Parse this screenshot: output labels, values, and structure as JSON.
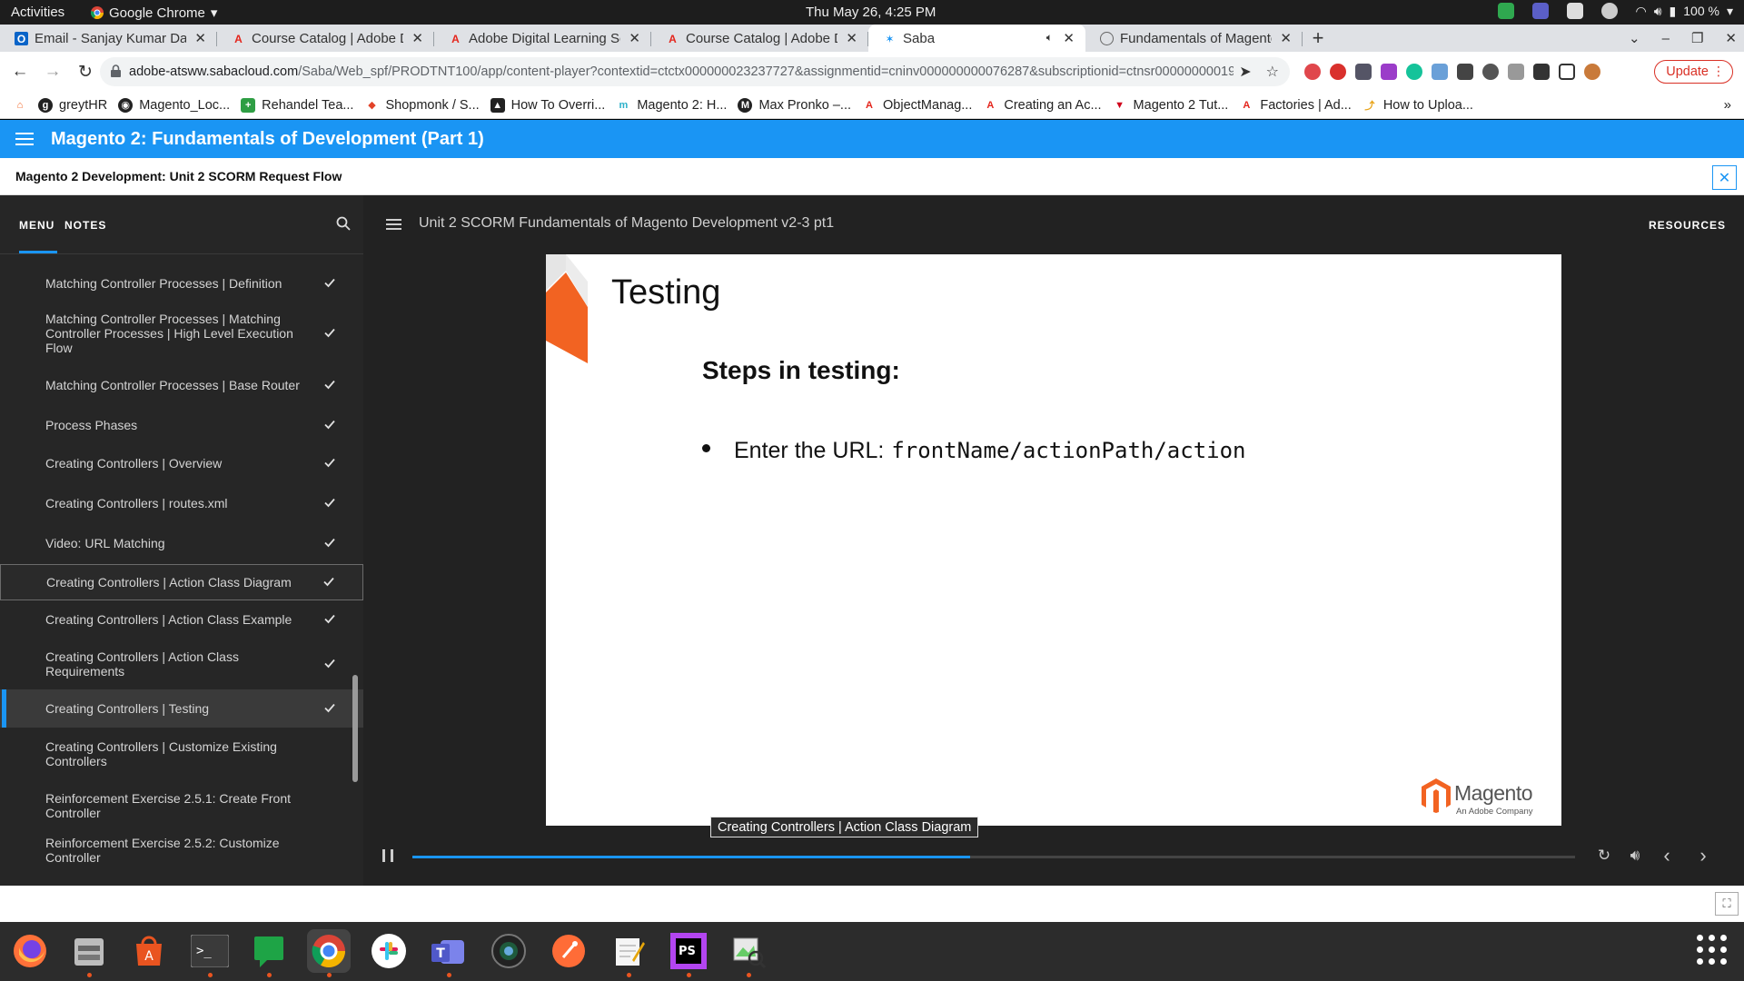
{
  "system": {
    "activities": "Activities",
    "app_name": "Google Chrome",
    "clock": "Thu May 26,  4:25 PM",
    "battery": "100 %"
  },
  "tabs": [
    {
      "label": "Email - Sanjay Kumar Das",
      "icon": "outlook-icon"
    },
    {
      "label": "Course Catalog | Adobe D",
      "icon": "adobe-icon"
    },
    {
      "label": "Adobe Digital Learning Se",
      "icon": "adobe-icon"
    },
    {
      "label": "Course Catalog | Adobe D",
      "icon": "adobe-icon"
    },
    {
      "label": "Saba",
      "icon": "saba-icon",
      "active": true
    },
    {
      "label": "Fundamentals of Magento",
      "icon": "globe-icon"
    }
  ],
  "toolbar": {
    "url_host": "adobe-atsww.sabacloud.com",
    "url_path": "/Saba/Web_spf/PRODTNT100/app/content-player?contextid=ctctx000000023237727&assignmentid=cninv000000000076287&subscriptionid=ctnsr00000000019...",
    "update_label": "Update"
  },
  "bookmarks": [
    {
      "label": "greytHR"
    },
    {
      "label": "Magento_Loc..."
    },
    {
      "label": "Rehandel Tea..."
    },
    {
      "label": "Shopmonk / S..."
    },
    {
      "label": "How To Overri..."
    },
    {
      "label": "Magento 2: H..."
    },
    {
      "label": "Max Pronko –..."
    },
    {
      "label": "ObjectManag..."
    },
    {
      "label": "Creating an Ac..."
    },
    {
      "label": "Magento 2 Tut..."
    },
    {
      "label": "Factories | Ad..."
    },
    {
      "label": "How to Uploa..."
    }
  ],
  "app": {
    "title": "Magento 2: Fundamentals of Development (Part 1)",
    "subtitle": "Magento 2 Development: Unit 2 SCORM Request Flow",
    "accent": "#1a95f4"
  },
  "sidebar": {
    "tab_menu": "MENU",
    "tab_notes": "NOTES",
    "items": [
      {
        "label": "Matching Controller Processes | Definition",
        "done": true
      },
      {
        "label": "Matching Controller Processes | Matching Controller Processes | High Level Execution Flow",
        "done": true
      },
      {
        "label": "Matching Controller Processes | Base Router",
        "done": true
      },
      {
        "label": "Process Phases",
        "done": true
      },
      {
        "label": "Creating Controllers | Overview",
        "done": true
      },
      {
        "label": "Creating Controllers | routes.xml",
        "done": true
      },
      {
        "label": "Video: URL Matching",
        "done": true
      },
      {
        "label": "Creating Controllers | Action Class Diagram",
        "done": true,
        "state": "hover"
      },
      {
        "label": "Creating Controllers | Action Class Example",
        "done": true
      },
      {
        "label": "Creating Controllers | Action Class Requirements",
        "done": true
      },
      {
        "label": "Creating Controllers | Testing",
        "done": true,
        "state": "current"
      },
      {
        "label": "Creating Controllers | Customize Existing Controllers",
        "done": false
      },
      {
        "label": "Reinforcement Exercise 2.5.1: Create Front Controller",
        "done": false
      },
      {
        "label": "Reinforcement Exercise 2.5.2: Customize Controller",
        "done": false
      }
    ]
  },
  "player": {
    "title": "Unit 2 SCORM Fundamentals of Magento Development v2-3 pt1",
    "resources": "RESOURCES",
    "progress": 0.48,
    "tooltip": "Creating Controllers | Action Class Diagram"
  },
  "slide": {
    "title": "Testing",
    "heading": "Steps in testing:",
    "bullet_text": "Enter the URL:",
    "bullet_code": "frontName/actionPath/action",
    "logo_word": "Magento",
    "logo_sub": "An Adobe Company"
  }
}
